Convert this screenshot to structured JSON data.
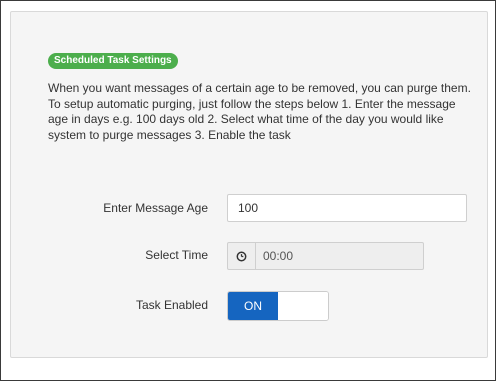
{
  "section": {
    "badge": "Scheduled Task Settings",
    "description": "When you want messages of a certain age to be removed, you can purge them. To setup automatic purging, just follow the steps below 1. Enter the message age in days e.g. 100 days old 2. Select what time of the day you would like system to purge messages 3. Enable the task"
  },
  "fields": {
    "age_label": "Enter Message Age",
    "age_value": "100",
    "time_label": "Select Time",
    "time_icon": "clock-icon",
    "time_value": "00:00",
    "task_label": "Task Enabled",
    "toggle_on_label": "ON",
    "toggle_state": true
  },
  "colors": {
    "badge": "#4cae4c",
    "toggle_on": "#1565c0"
  }
}
